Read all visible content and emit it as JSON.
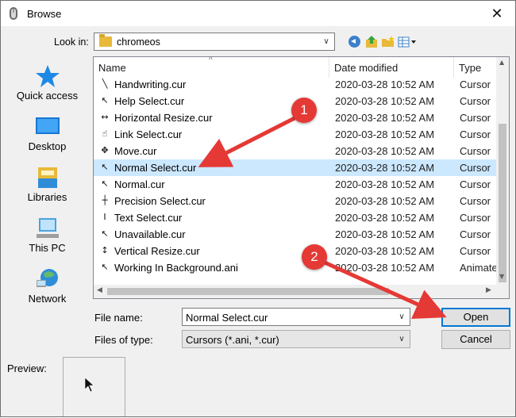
{
  "window": {
    "title": "Browse",
    "close_glyph": "✕"
  },
  "toolbar": {
    "look_in_label": "Look in:",
    "look_in_value": "chromeos",
    "icons": [
      "back-icon",
      "up-folder-icon",
      "new-folder-icon",
      "views-menu-icon"
    ]
  },
  "places": [
    {
      "label": "Quick access",
      "icon": "star-icon"
    },
    {
      "label": "Desktop",
      "icon": "desktop-icon"
    },
    {
      "label": "Libraries",
      "icon": "libraries-icon"
    },
    {
      "label": "This PC",
      "icon": "computer-icon"
    },
    {
      "label": "Network",
      "icon": "network-icon"
    }
  ],
  "file_list": {
    "columns": {
      "name": "Name",
      "date": "Date modified",
      "type": "Type"
    },
    "rows": [
      {
        "name": "Handwriting.cur",
        "date": "2020-03-28 10:52 AM",
        "type": "Cursor",
        "glyph": "╲",
        "selected": false
      },
      {
        "name": "Help Select.cur",
        "date": "2020-03-28 10:52 AM",
        "type": "Cursor",
        "glyph": "↖",
        "selected": false
      },
      {
        "name": "Horizontal Resize.cur",
        "date": "2020-03-28 10:52 AM",
        "type": "Cursor",
        "glyph": "↔",
        "selected": false
      },
      {
        "name": "Link Select.cur",
        "date": "2020-03-28 10:52 AM",
        "type": "Cursor",
        "glyph": "☝",
        "selected": false
      },
      {
        "name": "Move.cur",
        "date": "2020-03-28 10:52 AM",
        "type": "Cursor",
        "glyph": "✥",
        "selected": false
      },
      {
        "name": "Normal Select.cur",
        "date": "2020-03-28 10:52 AM",
        "type": "Cursor",
        "glyph": "↖",
        "selected": true
      },
      {
        "name": "Normal.cur",
        "date": "2020-03-28 10:52 AM",
        "type": "Cursor",
        "glyph": "↖",
        "selected": false
      },
      {
        "name": "Precision Select.cur",
        "date": "2020-03-28 10:52 AM",
        "type": "Cursor",
        "glyph": "┼",
        "selected": false
      },
      {
        "name": "Text Select.cur",
        "date": "2020-03-28 10:52 AM",
        "type": "Cursor",
        "glyph": "I",
        "selected": false
      },
      {
        "name": "Unavailable.cur",
        "date": "2020-03-28 10:52 AM",
        "type": "Cursor",
        "glyph": "↖",
        "selected": false
      },
      {
        "name": "Vertical Resize.cur",
        "date": "2020-03-28 10:52 AM",
        "type": "Cursor",
        "glyph": "↕",
        "selected": false
      },
      {
        "name": "Working In Background.ani",
        "date": "2020-03-28 10:52 AM",
        "type": "Animate",
        "glyph": "↖",
        "selected": false
      }
    ]
  },
  "form": {
    "file_name_label": "File name:",
    "file_name_value": "Normal Select.cur",
    "files_of_type_label": "Files of type:",
    "files_of_type_value": "Cursors (*.ani, *.cur)",
    "open_label": "Open",
    "cancel_label": "Cancel"
  },
  "preview": {
    "label": "Preview:",
    "glyph": "➤"
  },
  "annotations": {
    "badge1": "1",
    "badge2": "2",
    "color": "#e53935"
  },
  "colors": {
    "selection": "#cce8ff",
    "default_button_border": "#0078d7",
    "folder": "#e8b93a"
  }
}
